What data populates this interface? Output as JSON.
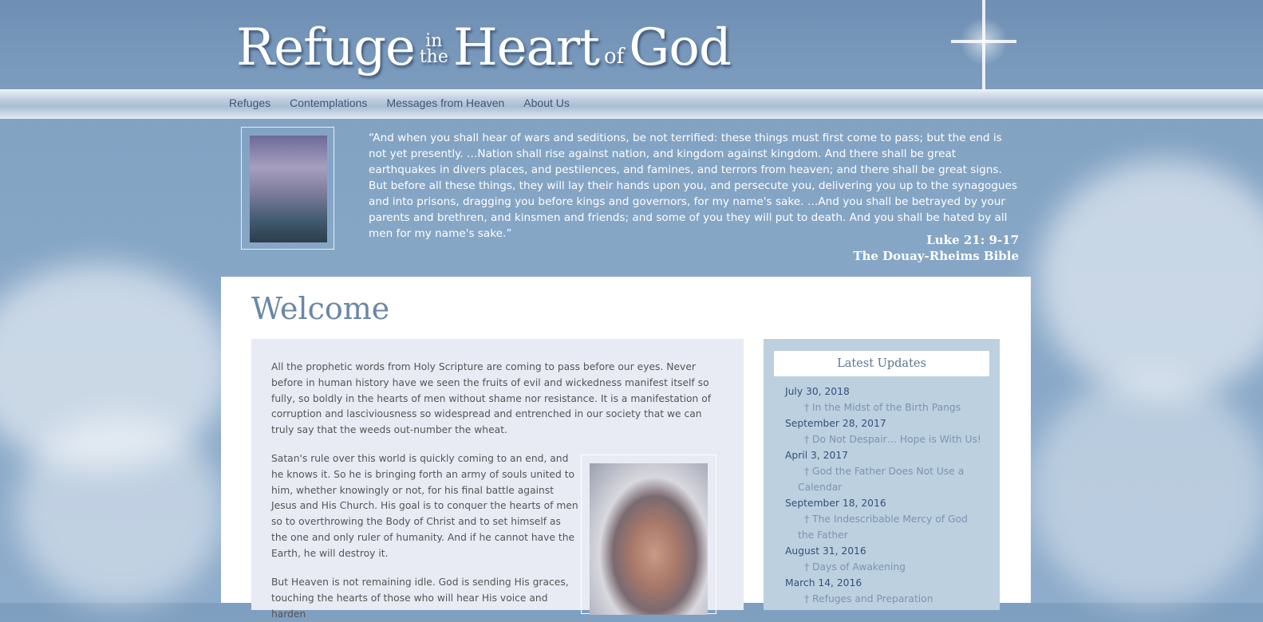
{
  "site": {
    "logo": {
      "part1": "Refuge",
      "in": "in",
      "the": "the",
      "part2": "Heart",
      "of": "of",
      "part3": "God"
    }
  },
  "nav": {
    "items": [
      {
        "label": "Refuges"
      },
      {
        "label": "Contemplations"
      },
      {
        "label": "Messages from Heaven"
      },
      {
        "label": "About Us"
      }
    ]
  },
  "quote": {
    "text": "“And when you shall hear of wars and seditions, be not terrified: these things must first come to pass; but the end is not yet presently. …Nation shall rise against nation, and kingdom against kingdom. And there shall be great earthquakes in divers places, and pestilences, and famines, and terrors from heaven; and there shall be great signs. But before all these things, they will lay their hands upon you, and persecute you, delivering you up to the synagogues and into prisons, dragging you before kings and governors, for my name's sake. …And you shall be betrayed by your parents and brethren, and kinsmen and friends; and some of you they will put to death. And you shall be hated by all men for my name's sake.”",
    "reference": "Luke 21: 9-17",
    "source": "The Douay-Rheims Bible"
  },
  "main": {
    "title": "Welcome",
    "paragraphs": [
      "All the prophetic words from Holy Scripture are coming to pass before our eyes.  Never before in human history have we seen the fruits of evil and wickedness manifest itself so fully, so boldly in the hearts of men without shame nor resistance.  It is a manifestation of corruption and lasciviousness so widespread and entrenched in our society that we can truly say that the weeds out-number the wheat.",
      "Satan's rule over this world is quickly coming to an end, and he knows it.  So he is bringing forth an army of souls united to him, whether knowingly or not, for his final battle against Jesus and His Church.  His goal is to conquer the hearts of men so to overthrowing the Body of Christ and to set himself as the one and only ruler of humanity.  And if he cannot have the Earth, he will destroy it.",
      "But Heaven is not remaining idle.  God is sending His graces, touching the hearts of those who will hear His voice and harden"
    ]
  },
  "sidebar": {
    "title": "Latest Updates",
    "updates": [
      {
        "date": "July 30, 2018",
        "title": "† In the Midst of the Birth Pangs"
      },
      {
        "date": "September 28, 2017",
        "title": "† Do Not Despair… Hope is With Us!"
      },
      {
        "date": "April 3, 2017",
        "title": "† God the Father Does Not Use a Calendar"
      },
      {
        "date": "September 18, 2016",
        "title": "† The Indescribable Mercy of God the Father"
      },
      {
        "date": "August 31, 2016",
        "title": "† Days of Awakening"
      },
      {
        "date": "March 14, 2016",
        "title": "† Refuges and Preparation"
      }
    ]
  }
}
